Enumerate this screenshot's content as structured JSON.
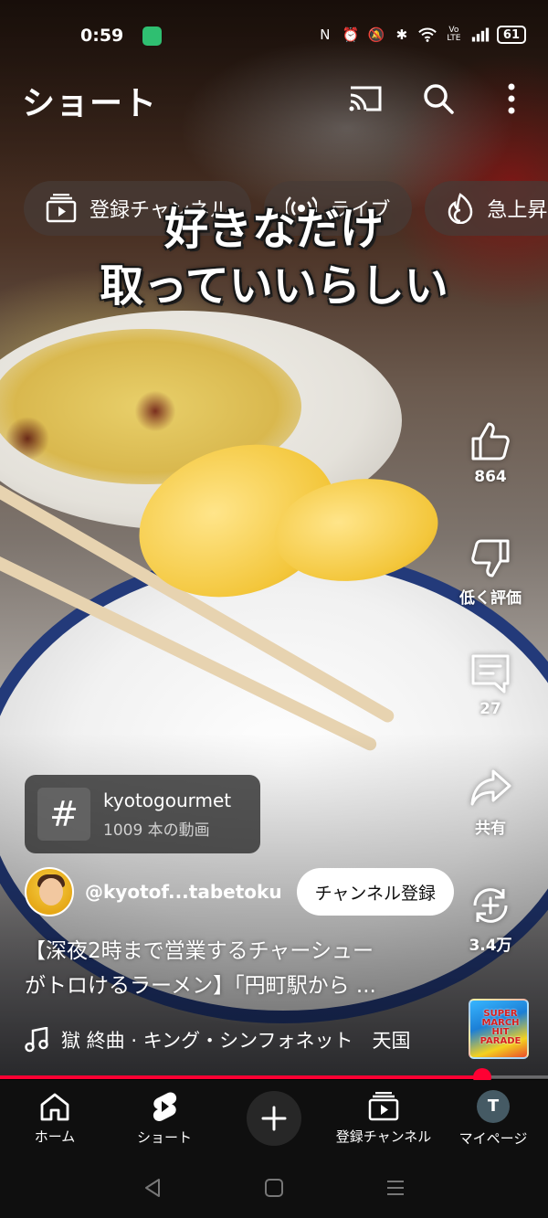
{
  "status_bar": {
    "time": "0:59",
    "network_label": "Vo LTE",
    "battery": "61"
  },
  "header": {
    "title": "ショート"
  },
  "chips": [
    {
      "label": "登録チャンネル",
      "icon": "subscriptions-icon"
    },
    {
      "label": "ライブ",
      "icon": "live-icon"
    },
    {
      "label": "急上昇",
      "icon": "trending-icon"
    }
  ],
  "video": {
    "overlay_caption": [
      "好きなだけ",
      "取っていいらしい"
    ],
    "likes": "864",
    "dislike_label": "低く評価",
    "comments": "27",
    "share_label": "共有",
    "remix_count": "3.4万",
    "hashtag": {
      "tag": "kyotogourmet",
      "count": "1009 本の動画"
    },
    "channel_handle": "@kyotof...tabetoku",
    "subscribe_label": "チャンネル登録",
    "title_lines": [
      "【深夜2時まで営業するチャーシュー",
      "がトロけるラーメン】「円町駅から ..."
    ],
    "music": "獄 終曲 · キング・シンフォネット　天国",
    "music_thumb_text": "SUPER MARCH HIT PARADE",
    "progress": 0.88
  },
  "bottom_nav": [
    {
      "label": "ホーム",
      "icon": "home-icon"
    },
    {
      "label": "ショート",
      "icon": "shorts-icon"
    },
    {
      "label": "",
      "icon": "create-icon"
    },
    {
      "label": "登録チャンネル",
      "icon": "subscriptions-icon"
    },
    {
      "label": "マイページ",
      "icon": "avatar"
    }
  ],
  "me_initial": "T",
  "colors": {
    "accent": "#ff0033",
    "nav_bg": "#0f0f0f",
    "chip_bg": "#463c37"
  }
}
